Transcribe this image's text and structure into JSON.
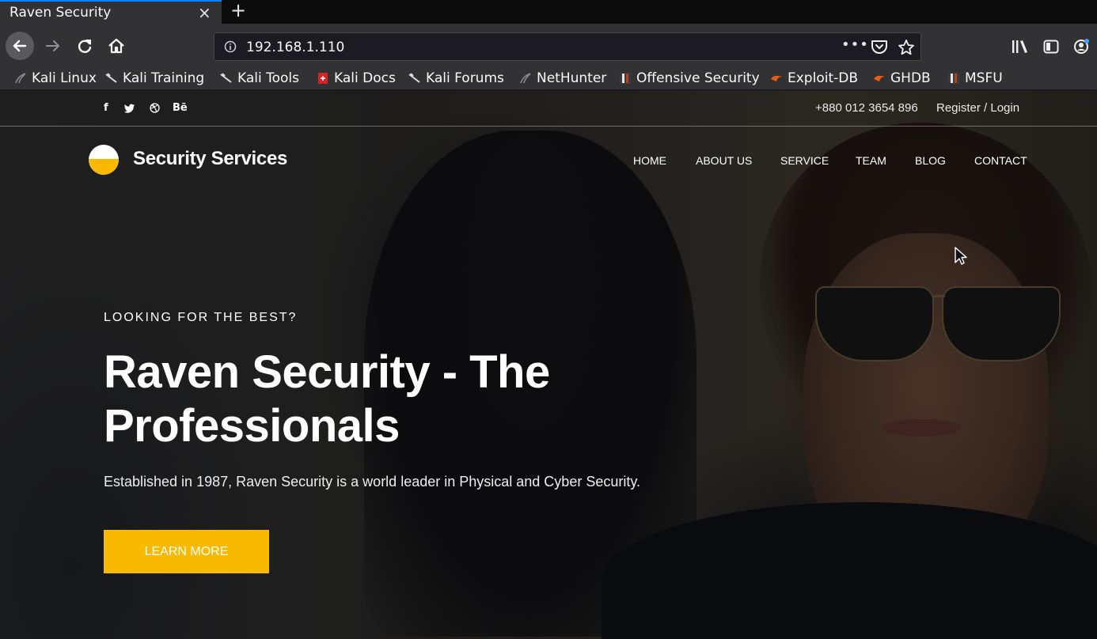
{
  "browser": {
    "tab_title": "Raven Security",
    "tab_close": "×",
    "new_tab": "+",
    "url": "192.168.1.110",
    "url_menu": "•••",
    "bookmarks": [
      {
        "label": "Kali Linux",
        "icon": "kali-dragon-icon"
      },
      {
        "label": "Kali Training",
        "icon": "kali-dragon-icon"
      },
      {
        "label": "Kali Tools",
        "icon": "kali-dragon-icon"
      },
      {
        "label": "Kali Docs",
        "icon": "kali-docs-icon"
      },
      {
        "label": "Kali Forums",
        "icon": "kali-dragon-icon"
      },
      {
        "label": "NetHunter",
        "icon": "nethunter-icon"
      },
      {
        "label": "Offensive Security",
        "icon": "offsec-icon"
      },
      {
        "label": "Exploit-DB",
        "icon": "exploitdb-icon"
      },
      {
        "label": "GHDB",
        "icon": "exploitdb-icon"
      },
      {
        "label": "MSFU",
        "icon": "offsec-icon"
      }
    ]
  },
  "site": {
    "social": [
      "f",
      "t",
      "d",
      "Bē"
    ],
    "phone": "+880 012 3654 896",
    "login": "Register / Login",
    "brand": "Security Services",
    "nav": [
      "HOME",
      "ABOUT US",
      "SERVICE",
      "TEAM",
      "BLOG",
      "CONTACT"
    ],
    "hero": {
      "eyebrow": "LOOKING FOR THE BEST?",
      "headline": "Raven Security - The Professionals",
      "subtext": "Established in 1987, Raven Security is a world leader in Physical and Cyber Security.",
      "cta": "LEARN MORE"
    }
  },
  "colors": {
    "accent": "#f9b900",
    "chrome": "#323234",
    "tab_highlight": "#0a84ff"
  }
}
